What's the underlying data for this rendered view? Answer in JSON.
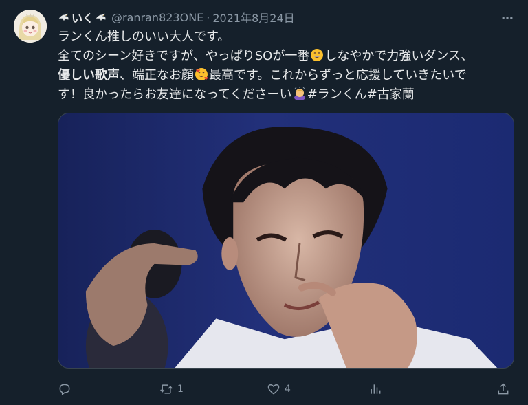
{
  "colors": {
    "background": "#15202b",
    "text_primary": "#e7e9ea",
    "text_secondary": "#8b98a5",
    "border": "#38444d"
  },
  "author": {
    "display_name": "いく",
    "name_emoji_icon": "eagle-icon",
    "handle": "@ranran823ONE",
    "separator": "·",
    "date": "2021年8月24日"
  },
  "tweet": {
    "line1": "ランくん推しのいい大人です。",
    "line2_a": "全てのシーン好きですが、やっぱりSOが一番",
    "line2_emoji_icon": "grinning-face-icon",
    "line2_b": "しなやかで力強いダンス、",
    "line3_bold1": "優しい歌声",
    "line3_a": "、端正なお顔",
    "line3_emoji_icon": "smiling-face-hearts-icon",
    "line3_b": "最高です。これからずっと応援していきたいで",
    "line4_a": "す！良かったらお友達になってくださーい",
    "line4_emoji_icon": "person-bowing-icon",
    "hashtag1": "#ランくん",
    "hashtag2": "#古家蘭"
  },
  "media": {
    "icon": "photo-icon"
  },
  "actions": {
    "reply_icon": "reply-icon",
    "retweet_icon": "retweet-icon",
    "retweet_count": "1",
    "like_icon": "heart-icon",
    "like_count": "4",
    "views_icon": "views-icon",
    "share_icon": "share-icon"
  }
}
